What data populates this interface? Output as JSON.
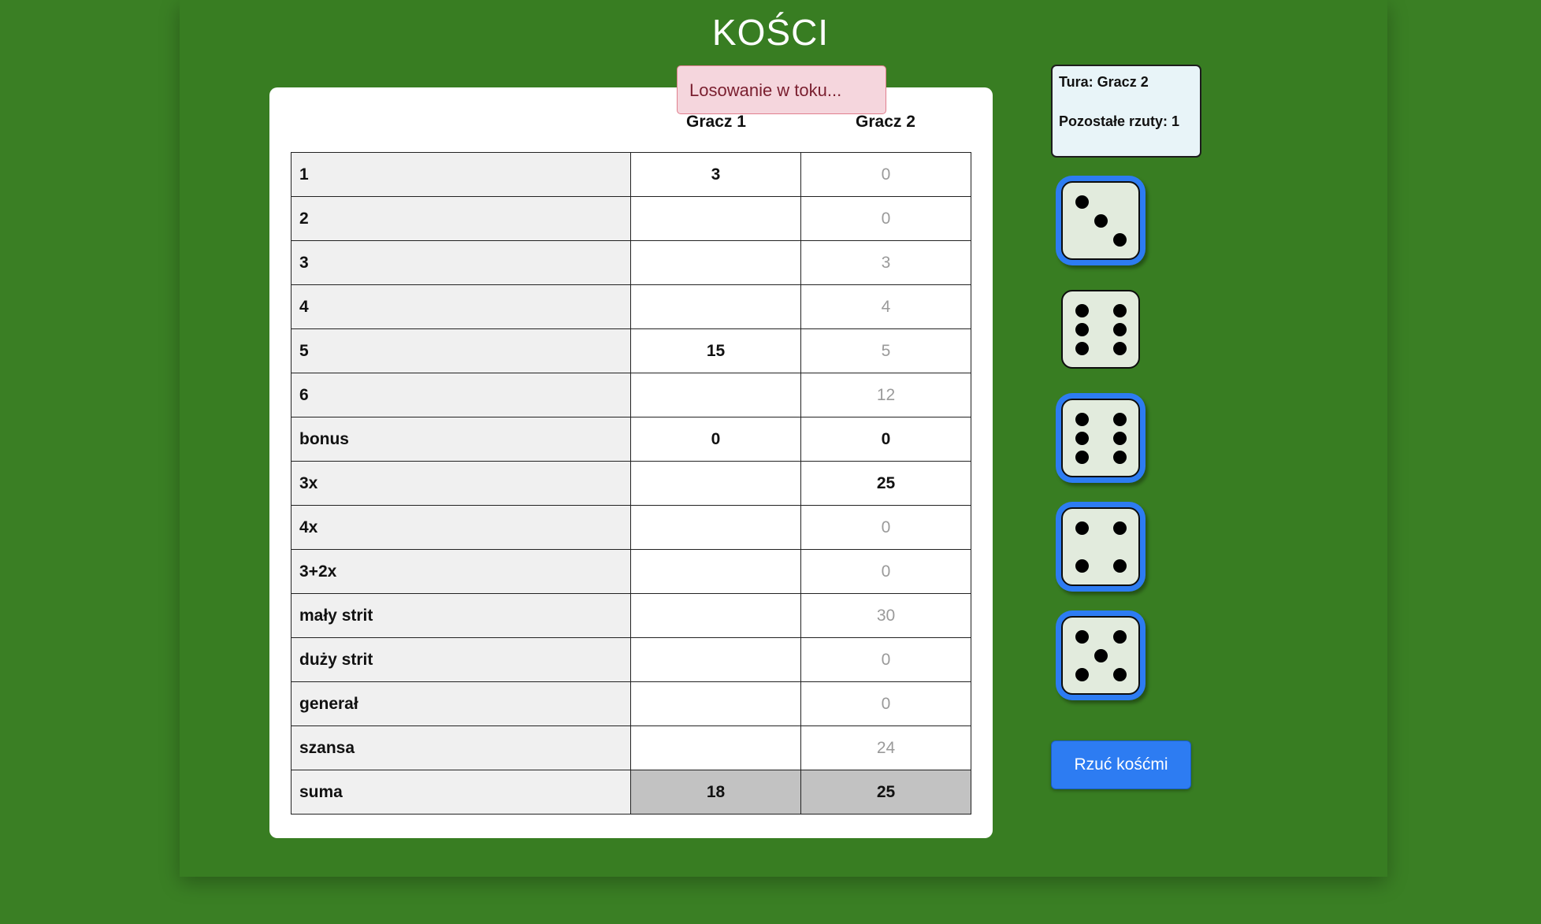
{
  "title": "KOŚCI",
  "toast": "Losowanie w toku...",
  "players": [
    "Gracz 1",
    "Gracz 2"
  ],
  "status": {
    "turn": "Tura: Gracz 2",
    "rolls_left": "Pozostałe rzuty: 1"
  },
  "scoreboard": {
    "rows": [
      {
        "label": "1",
        "p1": "3",
        "p2": "0",
        "p2_fixed": false
      },
      {
        "label": "2",
        "p1": "",
        "p2": "0",
        "p2_fixed": false
      },
      {
        "label": "3",
        "p1": "",
        "p2": "3",
        "p2_fixed": false
      },
      {
        "label": "4",
        "p1": "",
        "p2": "4",
        "p2_fixed": false
      },
      {
        "label": "5",
        "p1": "15",
        "p2": "5",
        "p2_fixed": false
      },
      {
        "label": "6",
        "p1": "",
        "p2": "12",
        "p2_fixed": false
      },
      {
        "label": "bonus",
        "p1": "0",
        "p2": "0",
        "p2_fixed": true
      },
      {
        "label": "3x",
        "p1": "",
        "p2": "25",
        "p2_fixed": true
      },
      {
        "label": "4x",
        "p1": "",
        "p2": "0",
        "p2_fixed": false
      },
      {
        "label": "3+2x",
        "p1": "",
        "p2": "0",
        "p2_fixed": false
      },
      {
        "label": "mały strit",
        "p1": "",
        "p2": "30",
        "p2_fixed": false
      },
      {
        "label": "duży strit",
        "p1": "",
        "p2": "0",
        "p2_fixed": false
      },
      {
        "label": "generał",
        "p1": "",
        "p2": "0",
        "p2_fixed": false
      },
      {
        "label": "szansa",
        "p1": "",
        "p2": "24",
        "p2_fixed": false
      }
    ],
    "total": {
      "label": "suma",
      "p1": "18",
      "p2": "25"
    }
  },
  "dice": [
    {
      "value": 3,
      "held": true
    },
    {
      "value": 6,
      "held": false
    },
    {
      "value": 6,
      "held": true
    },
    {
      "value": 4,
      "held": true
    },
    {
      "value": 5,
      "held": true
    }
  ],
  "colors": {
    "background": "#3a7f24",
    "held_outline": "#2d7cf2",
    "button": "#2d7cf2",
    "toast_bg": "#f5d6dd"
  },
  "roll_button": "Rzuć kośćmi"
}
